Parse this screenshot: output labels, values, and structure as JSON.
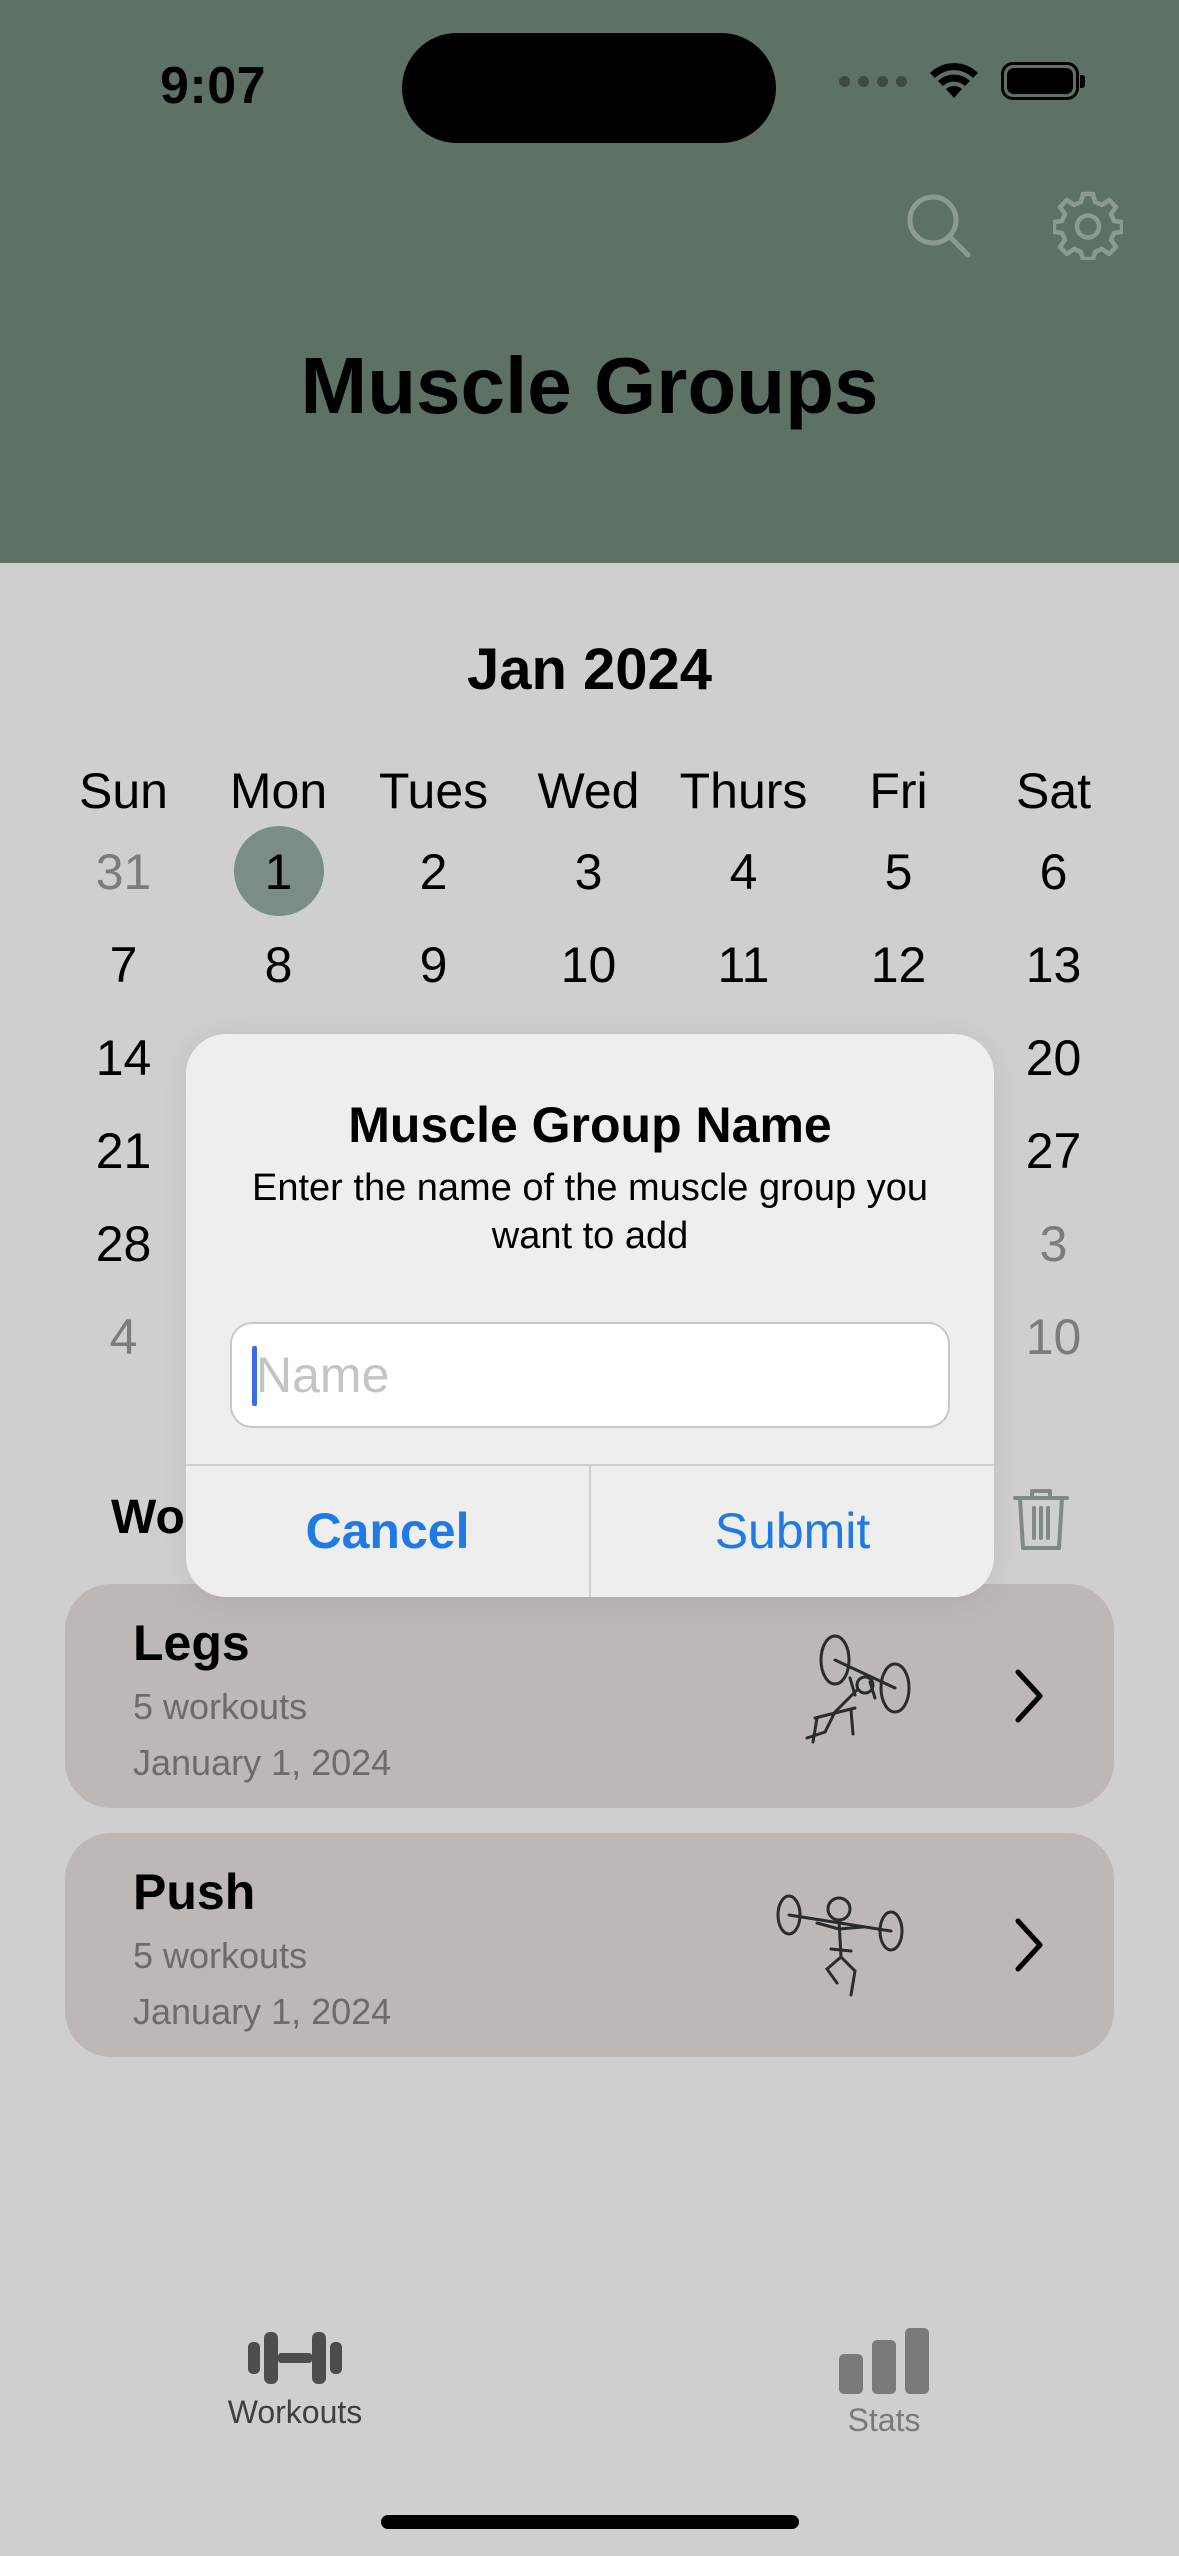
{
  "status_bar": {
    "time": "9:07"
  },
  "header": {
    "title": "Muscle Groups"
  },
  "calendar": {
    "month": "Jan 2024",
    "weekdays": [
      "Sun",
      "Mon",
      "Tues",
      "Wed",
      "Thurs",
      "Fri",
      "Sat"
    ],
    "weeks": [
      [
        "31",
        "1",
        "2",
        "3",
        "4",
        "5",
        "6"
      ],
      [
        "7",
        "8",
        "9",
        "10",
        "11",
        "12",
        "13"
      ],
      [
        "14",
        "",
        "",
        "",
        "",
        "",
        "20"
      ],
      [
        "21",
        "",
        "",
        "",
        "",
        "",
        "27"
      ],
      [
        "28",
        "",
        "",
        "",
        "",
        "",
        "3"
      ],
      [
        "4",
        "",
        "",
        "",
        "",
        "",
        "10"
      ]
    ],
    "selected_day": "1"
  },
  "workouts_section": {
    "title": "Wo"
  },
  "cards": [
    {
      "title": "Legs",
      "count": "5 workouts",
      "date": "January 1, 2024",
      "icon": "bench-press-sketch-icon"
    },
    {
      "title": "Push",
      "count": "5 workouts",
      "date": "January 1, 2024",
      "icon": "overhead-press-sketch-icon"
    }
  ],
  "tabs": [
    {
      "label": "Workouts",
      "icon": "dumbbell-icon",
      "selected": true
    },
    {
      "label": "Stats",
      "icon": "bar-chart-icon",
      "selected": false
    }
  ],
  "dialog": {
    "title": "Muscle Group Name",
    "message": "Enter the name of the muscle group you want to add",
    "input_placeholder": "Name",
    "input_value": "",
    "cancel_label": "Cancel",
    "submit_label": "Submit"
  },
  "colors": {
    "header_bg": "#5d7264",
    "page_bg": "#cfcfcf",
    "card_bg": "#bdb7b6",
    "selected_day": "#7c8c87",
    "dialog_bg": "#eeeeee",
    "accent_blue": "#1f7ae6"
  }
}
